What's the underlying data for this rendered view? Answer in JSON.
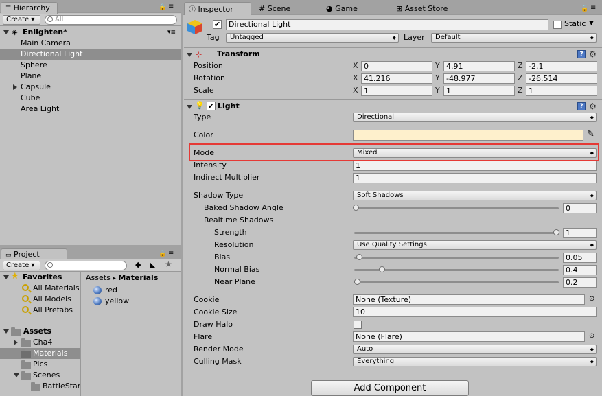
{
  "hierarchy": {
    "tab": "Hierarchy",
    "create_label": "Create",
    "search_placeholder": "All",
    "scene_name": "Enlighten*",
    "items": [
      "Main Camera",
      "Directional Light",
      "Sphere",
      "Plane",
      "Capsule",
      "Cube",
      "Area Light"
    ]
  },
  "project": {
    "tab": "Project",
    "create_label": "Create",
    "favorites_label": "Favorites",
    "favorites": [
      "All Materials",
      "All Models",
      "All Prefabs"
    ],
    "assets_label": "Assets",
    "assets": [
      "Cha4",
      "Materials",
      "Pics",
      "Scenes",
      "BattleStar"
    ],
    "breadcrumb_root": "Assets",
    "breadcrumb_sep": "▸",
    "breadcrumb_current": "Materials",
    "files": [
      "red",
      "yellow"
    ]
  },
  "tabs": {
    "inspector": "Inspector",
    "scene": "Scene",
    "game": "Game",
    "asset_store": "Asset Store"
  },
  "object": {
    "name": "Directional Light",
    "static_label": "Static",
    "tag_label": "Tag",
    "tag_value": "Untagged",
    "layer_label": "Layer",
    "layer_value": "Default"
  },
  "transform": {
    "title": "Transform",
    "position_label": "Position",
    "rotation_label": "Rotation",
    "scale_label": "Scale",
    "x": "X",
    "y": "Y",
    "z": "Z",
    "position": [
      "0",
      "4.91",
      "-2.1"
    ],
    "rotation": [
      "41.216",
      "-48.977",
      "-26.514"
    ],
    "scale": [
      "1",
      "1",
      "1"
    ]
  },
  "light": {
    "title": "Light",
    "type_label": "Type",
    "type_value": "Directional",
    "color_label": "Color",
    "color_value": "#fef0cc",
    "mode_label": "Mode",
    "mode_value": "Mixed",
    "intensity_label": "Intensity",
    "intensity_value": "1",
    "indirect_label": "Indirect Multiplier",
    "indirect_value": "1",
    "shadow_type_label": "Shadow Type",
    "shadow_type_value": "Soft Shadows",
    "baked_angle_label": "Baked Shadow Angle",
    "baked_angle_value": "0",
    "realtime_label": "Realtime Shadows",
    "strength_label": "Strength",
    "strength_value": "1",
    "resolution_label": "Resolution",
    "resolution_value": "Use Quality Settings",
    "bias_label": "Bias",
    "bias_value": "0.05",
    "normal_bias_label": "Normal Bias",
    "normal_bias_value": "0.4",
    "near_plane_label": "Near Plane",
    "near_plane_value": "0.2",
    "cookie_label": "Cookie",
    "cookie_value": "None (Texture)",
    "cookie_size_label": "Cookie Size",
    "cookie_size_value": "10",
    "draw_halo_label": "Draw Halo",
    "flare_label": "Flare",
    "flare_value": "None (Flare)",
    "render_mode_label": "Render Mode",
    "render_mode_value": "Auto",
    "culling_label": "Culling Mask",
    "culling_value": "Everything"
  },
  "add_component": "Add Component",
  "colors": {
    "highlight": "#e53935",
    "selection": "#8e8e8e"
  }
}
